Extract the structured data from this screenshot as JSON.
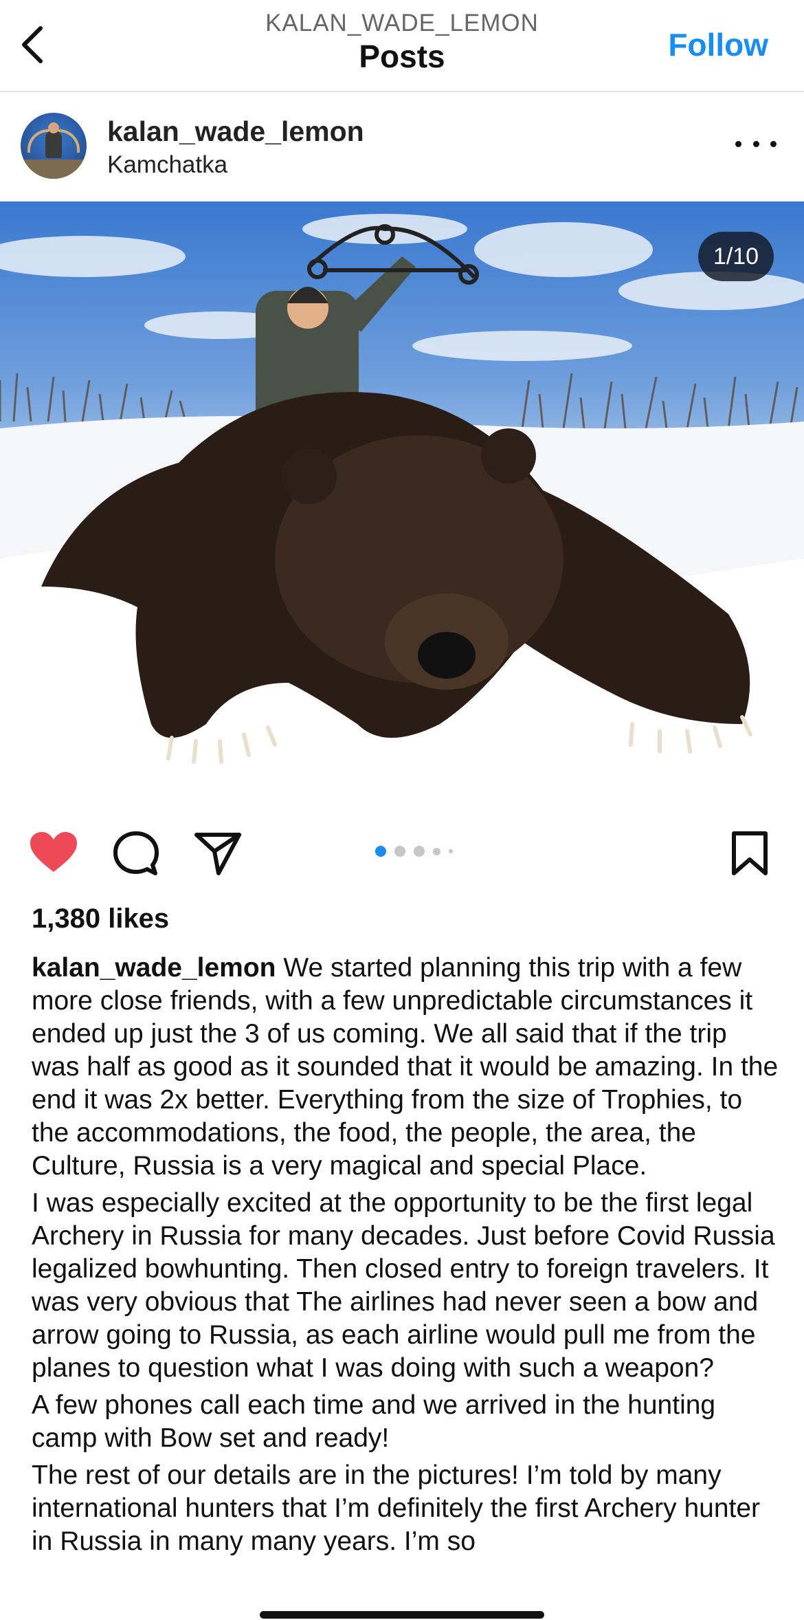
{
  "header": {
    "username_caps": "KALAN_WADE_LEMON",
    "title": "Posts",
    "follow_label": "Follow"
  },
  "post": {
    "username": "kalan_wade_lemon",
    "location": "Kamchatka",
    "image_counter": "1/10",
    "carousel_dots": 5,
    "carousel_active_index": 0,
    "likes": "1,380 likes",
    "caption_user": "kalan_wade_lemon",
    "caption_paragraphs": [
      " We started planning this trip with a few more close friends, with a few unpredictable circumstances it ended up just the 3 of us coming. We all said that if the trip was half as good as it sounded that it would be amazing. In the end it was 2x better. Everything from the size of Trophies, to the accommodations, the food, the people, the area, the Culture, Russia is a very magical and special Place.",
      "I was especially excited at the opportunity to be the first legal Archery in Russia for many decades. Just before Covid Russia legalized bowhunting. Then closed entry to foreign travelers. It was very obvious that The airlines had never seen a bow and arrow going to Russia, as each airline would pull me from the planes to question what I was doing with such a weapon?",
      "A few phones call each time and we arrived in the hunting camp with Bow set and ready!",
      "The rest of our details are in the pictures! I’m told by many international hunters that I’m definitely the first Archery hunter in Russia in many many years. I’m so"
    ]
  },
  "icons": {
    "back": "chevron-left-icon",
    "more": "more-horizontal-icon",
    "like": "heart-filled-icon",
    "comment": "comment-bubble-icon",
    "share": "paper-plane-icon",
    "save": "bookmark-icon"
  },
  "colors": {
    "accent": "#1a8ef0",
    "like": "#ed4956",
    "active_dot": "#1a8ef0"
  }
}
